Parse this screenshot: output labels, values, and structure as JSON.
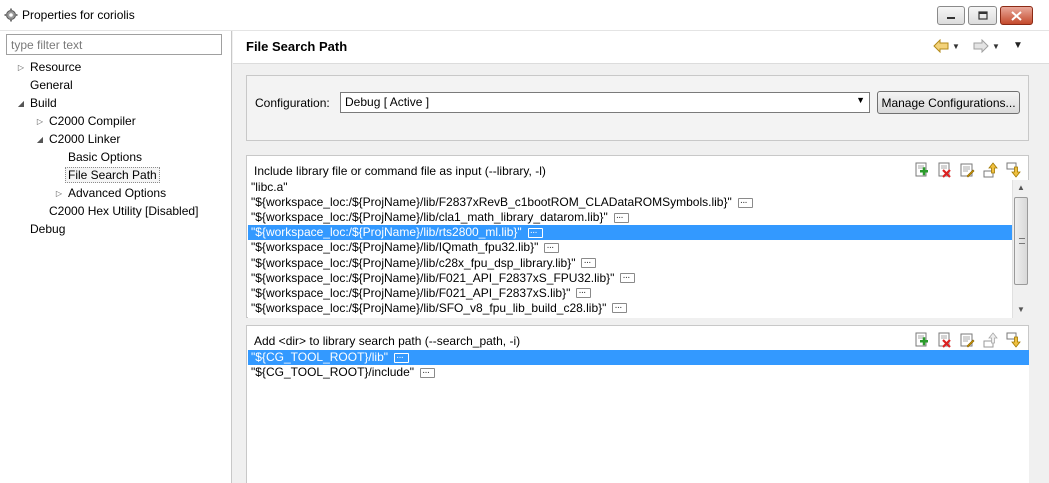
{
  "window": {
    "title": "Properties for coriolis",
    "icons": {
      "app": "gear-icon",
      "minimize": "minimize-icon",
      "maximize": "maximize-icon",
      "close": "close-icon"
    }
  },
  "filter": {
    "placeholder": "type filter text",
    "value": ""
  },
  "tree": {
    "items": [
      {
        "label": "Resource",
        "arrow": "collapsed"
      },
      {
        "label": "General",
        "arrow": "none"
      },
      {
        "label": "Build",
        "arrow": "expanded"
      },
      {
        "label": "C2000 Compiler",
        "arrow": "collapsed"
      },
      {
        "label": "C2000 Linker",
        "arrow": "expanded"
      },
      {
        "label": "Basic Options",
        "arrow": "none"
      },
      {
        "label": "File Search Path",
        "arrow": "none",
        "selected": true
      },
      {
        "label": "Advanced Options",
        "arrow": "collapsed"
      },
      {
        "label": "C2000 Hex Utility  [Disabled]",
        "arrow": "none"
      },
      {
        "label": "Debug",
        "arrow": "none"
      }
    ]
  },
  "page": {
    "title": "File Search Path",
    "nav_icons": {
      "back": "back-arrow-icon",
      "forward": "forward-arrow-icon",
      "menu": "view-menu-icon"
    }
  },
  "configuration": {
    "label": "Configuration:",
    "selected": "Debug  [ Active ]",
    "manage_label": "Manage Configurations..."
  },
  "library_section": {
    "header": "Include library file or command file as input (--library, -l)",
    "items": [
      {
        "text": "\"libc.a\"",
        "ellipsis": false,
        "selected": false
      },
      {
        "text": "\"${workspace_loc:/${ProjName}/lib/F2837xRevB_c1bootROM_CLADataROMSymbols.lib}\"",
        "ellipsis": true,
        "selected": false
      },
      {
        "text": "\"${workspace_loc:/${ProjName}/lib/cla1_math_library_datarom.lib}\"",
        "ellipsis": true,
        "selected": false
      },
      {
        "text": "\"${workspace_loc:/${ProjName}/lib/rts2800_ml.lib}\"",
        "ellipsis": true,
        "selected": true
      },
      {
        "text": "\"${workspace_loc:/${ProjName}/lib/IQmath_fpu32.lib}\"",
        "ellipsis": true,
        "selected": false
      },
      {
        "text": "\"${workspace_loc:/${ProjName}/lib/c28x_fpu_dsp_library.lib}\"",
        "ellipsis": true,
        "selected": false
      },
      {
        "text": "\"${workspace_loc:/${ProjName}/lib/F021_API_F2837xS_FPU32.lib}\"",
        "ellipsis": true,
        "selected": false
      },
      {
        "text": "\"${workspace_loc:/${ProjName}/lib/F021_API_F2837xS.lib}\"",
        "ellipsis": true,
        "selected": false
      },
      {
        "text": "\"${workspace_loc:/${ProjName}/lib/SFO_v8_fpu_lib_build_c28.lib}\"",
        "ellipsis": true,
        "selected": false
      }
    ]
  },
  "path_section": {
    "header": "Add <dir> to library search path (--search_path, -i)",
    "items": [
      {
        "text": "\"${CG_TOOL_ROOT}/lib\"",
        "ellipsis": true,
        "selected": true
      },
      {
        "text": "\"${CG_TOOL_ROOT}/include\"",
        "ellipsis": true,
        "selected": false
      }
    ]
  },
  "tools": [
    "add-icon",
    "delete-icon",
    "edit-icon",
    "move-up-icon",
    "move-down-icon"
  ],
  "colors": {
    "selection": "#3399ff",
    "accent_tool": "#d49a00"
  }
}
